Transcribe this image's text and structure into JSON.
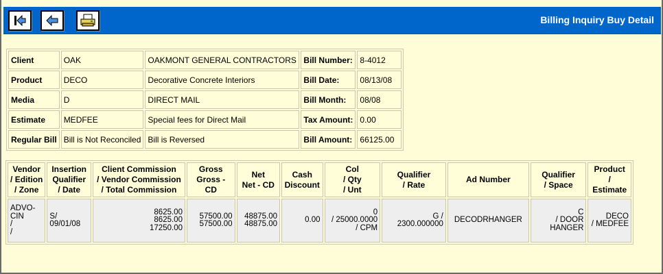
{
  "header": {
    "title": "Billing Inquiry Buy Detail",
    "accent_color": "#0066cc",
    "background_color": "#fffdd8",
    "buttons": [
      {
        "name": "first-record-button",
        "icon": "skip-to-first-icon"
      },
      {
        "name": "back-button",
        "icon": "arrow-left-icon"
      },
      {
        "name": "print-button",
        "icon": "printer-icon"
      }
    ]
  },
  "info": {
    "rows": [
      {
        "label": "Client",
        "code": "OAK",
        "desc": "OAKMONT GENERAL CONTRACTORS",
        "field": "Bill Number:",
        "value": "8-4012"
      },
      {
        "label": "Product",
        "code": "DECO",
        "desc": "Decorative Concrete Interiors",
        "field": "Bill Date:",
        "value": "08/13/08"
      },
      {
        "label": "Media",
        "code": "D",
        "desc": "DIRECT MAIL",
        "field": "Bill Month:",
        "value": "08/08"
      },
      {
        "label": "Estimate",
        "code": "MEDFEE",
        "desc": "Special fees for Direct Mail",
        "field": "Tax Amount:",
        "value": "0.00"
      },
      {
        "label": "Regular Bill",
        "code": "Bill is Not Reconciled",
        "desc": "Bill is Reversed",
        "field": "Bill Amount:",
        "value": "66125.00"
      }
    ]
  },
  "grid": {
    "headers": [
      [
        "Vendor",
        "/ Edition",
        "/ Zone"
      ],
      [
        "Insertion",
        "Qualifier",
        "/ Date"
      ],
      [
        "Client Commission",
        "/ Vendor Commission",
        "/ Total Commission"
      ],
      [
        "Gross",
        "Gross - CD"
      ],
      [
        "Net",
        "Net - CD"
      ],
      [
        "Cash",
        "Discount"
      ],
      [
        "Col",
        "/ Qty",
        "/ Unt"
      ],
      [
        "Qualifier",
        "/ Rate"
      ],
      [
        "Ad Number"
      ],
      [
        "Qualifier",
        "/ Space"
      ],
      [
        "Product",
        "/ Estimate"
      ]
    ],
    "rows": [
      [
        [
          "ADVO-",
          "CIN",
          "/",
          "/"
        ],
        [
          "S/",
          "09/01/08"
        ],
        [
          "8625.00",
          "8625.00",
          "17250.00"
        ],
        [
          "57500.00",
          "57500.00"
        ],
        [
          "48875.00",
          "48875.00"
        ],
        [
          "0.00"
        ],
        [
          "0",
          "/ 25000.0000",
          "/ CPM"
        ],
        [
          "G /",
          "2300.000000"
        ],
        [
          "DECODRHANGER"
        ],
        [
          "C",
          "/ DOOR",
          "HANGER"
        ],
        [
          "DECO",
          "/ MEDFEE"
        ]
      ]
    ]
  }
}
